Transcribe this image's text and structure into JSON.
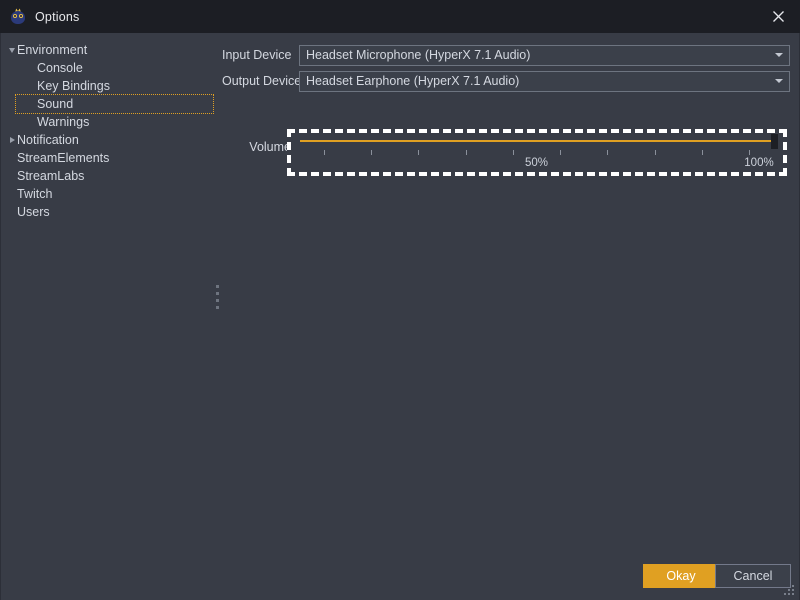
{
  "window": {
    "title": "Options",
    "icon": "owl-mascot-icon",
    "close_label": "✕",
    "bg_color": "#383c46",
    "titlebar_color": "#1c1e24"
  },
  "sidebar": {
    "items": [
      {
        "label": "Environment",
        "indent": 0,
        "arrow": "down",
        "selected": false
      },
      {
        "label": "Console",
        "indent": 1,
        "arrow": "none",
        "selected": false
      },
      {
        "label": "Key Bindings",
        "indent": 1,
        "arrow": "none",
        "selected": false
      },
      {
        "label": "Sound",
        "indent": 1,
        "arrow": "none",
        "selected": true
      },
      {
        "label": "Warnings",
        "indent": 1,
        "arrow": "none",
        "selected": false
      },
      {
        "label": "Notification",
        "indent": 0,
        "arrow": "right",
        "selected": false
      },
      {
        "label": "StreamElements",
        "indent": 0,
        "arrow": "none",
        "selected": false
      },
      {
        "label": "StreamLabs",
        "indent": 0,
        "arrow": "none",
        "selected": false
      },
      {
        "label": "Twitch",
        "indent": 0,
        "arrow": "none",
        "selected": false
      },
      {
        "label": "Users",
        "indent": 0,
        "arrow": "none",
        "selected": false
      }
    ]
  },
  "settings": {
    "input_device": {
      "label": "Input Device",
      "value": "Headset Microphone (HyperX 7.1 Audio)"
    },
    "output_device": {
      "label": "Output Device",
      "value": "Headset Earphone (HyperX 7.1 Audio)"
    },
    "volume": {
      "label": "Volume",
      "value": 100,
      "min": 0,
      "max": 100,
      "focused": true,
      "accent_color": "#e0a022",
      "tick_count": 10,
      "tick_labels": [
        {
          "text": "50%",
          "position": 50
        },
        {
          "text": "100%",
          "position": 100
        }
      ]
    }
  },
  "footer": {
    "okay_label": "Okay",
    "cancel_label": "Cancel",
    "primary_color": "#e0a022"
  }
}
